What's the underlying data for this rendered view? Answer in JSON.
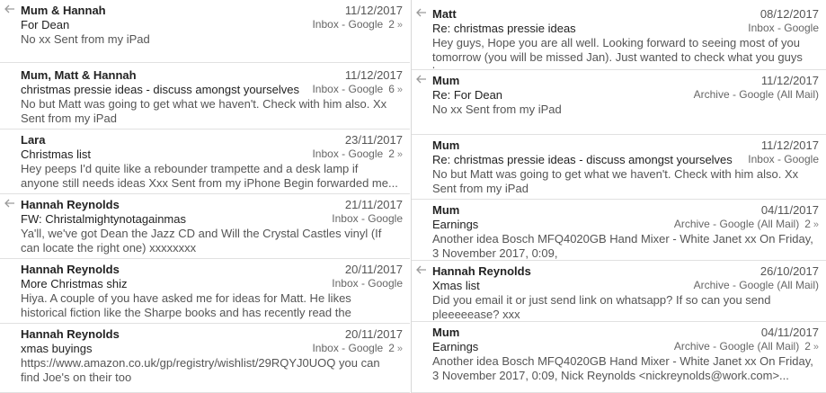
{
  "left": [
    {
      "sender": "Mum & Hannah",
      "date": "11/12/2017",
      "subject": "For Dean",
      "mailbox": "Inbox - Google",
      "count": "2",
      "chevron": "»",
      "preview": "No xx Sent from my iPad",
      "replied": true
    },
    {
      "sender": "Mum, Matt & Hannah",
      "date": "11/12/2017",
      "subject": "christmas pressie ideas - discuss amongst yourselves",
      "mailbox": "Inbox - Google",
      "count": "6",
      "chevron": "»",
      "preview": "No but Matt was going to get what we haven't. Check with him also. Xx Sent from my iPad",
      "replied": false
    },
    {
      "sender": "Lara",
      "date": "23/11/2017",
      "subject": "Christmas list",
      "mailbox": "Inbox - Google",
      "count": "2",
      "chevron": "»",
      "preview": "Hey peeps I'd quite like a rebounder trampette and a desk lamp if anyone still needs ideas Xxx Sent from my iPhone Begin forwarded me...",
      "replied": false
    },
    {
      "sender": "Hannah Reynolds",
      "date": "21/11/2017",
      "subject": "FW: Christalmightynotagainmas",
      "mailbox": "Inbox - Google",
      "count": "",
      "chevron": "",
      "preview": "Ya'll, we've got Dean the Jazz CD and Will the Crystal Castles vinyl (If can locate the right one) xxxxxxxx",
      "replied": true
    },
    {
      "sender": "Hannah Reynolds",
      "date": "20/11/2017",
      "subject": "More Christmas shiz",
      "mailbox": "Inbox - Google",
      "count": "",
      "chevron": "",
      "preview": "Hiya. A couple of you have asked me for ideas for Matt. He likes historical fiction like the Sharpe books and has recently read the Bretherin trilogy boo...",
      "replied": false
    },
    {
      "sender": "Hannah Reynolds",
      "date": "20/11/2017",
      "subject": "xmas buyings",
      "mailbox": "Inbox - Google",
      "count": "2",
      "chevron": "»",
      "preview": "https://www.amazon.co.uk/gp/registry/wishlist/29RQYJ0UOQ you can find Joe's on their too",
      "replied": false
    }
  ],
  "right": [
    {
      "sender": "Matt",
      "date": "08/12/2017",
      "subject": "Re: christmas pressie ideas",
      "mailbox": "Inbox - Google",
      "count": "",
      "chevron": "",
      "preview": "Hey guys, Hope you are all well. Looking forward to seeing most of you tomorrow (you will be missed Jan). Just wanted to check what you guys ha...",
      "replied": true
    },
    {
      "sender": "Mum",
      "date": "11/12/2017",
      "subject": "Re: For Dean",
      "mailbox": "Archive - Google (All Mail)",
      "count": "",
      "chevron": "",
      "preview": "No xx Sent from my iPad",
      "replied": true
    },
    {
      "sender": "Mum",
      "date": "11/12/2017",
      "subject": "Re: christmas pressie ideas - discuss amongst yourselves",
      "mailbox": "Inbox - Google",
      "count": "",
      "chevron": "",
      "preview": "No but Matt was going to get what we haven't. Check with him also. Xx Sent from my iPad",
      "replied": false
    },
    {
      "sender": "Mum",
      "date": "04/11/2017",
      "subject": "Earnings",
      "mailbox": "Archive - Google (All Mail)",
      "count": "2",
      "chevron": "»",
      "preview": "Another idea Bosch MFQ4020GB Hand Mixer - White Janet xx On Friday, 3 November 2017, 0:09,",
      "replied": false
    },
    {
      "sender": "Hannah Reynolds",
      "date": "26/10/2017",
      "subject": "Xmas list",
      "mailbox": "Archive - Google (All Mail)",
      "count": "",
      "chevron": "",
      "preview": "Did you email it or just send link on whatsapp? If so can you send pleeeeease? xxx",
      "replied": true
    },
    {
      "sender": "Mum",
      "date": "04/11/2017",
      "subject": "Earnings",
      "mailbox": "Archive - Google (All Mail)",
      "count": "2",
      "chevron": "»",
      "preview": "Another idea Bosch MFQ4020GB Hand Mixer - White Janet xx On Friday, 3 November 2017, 0:09, Nick Reynolds <nickreynolds@work.com>...",
      "replied": false
    }
  ]
}
